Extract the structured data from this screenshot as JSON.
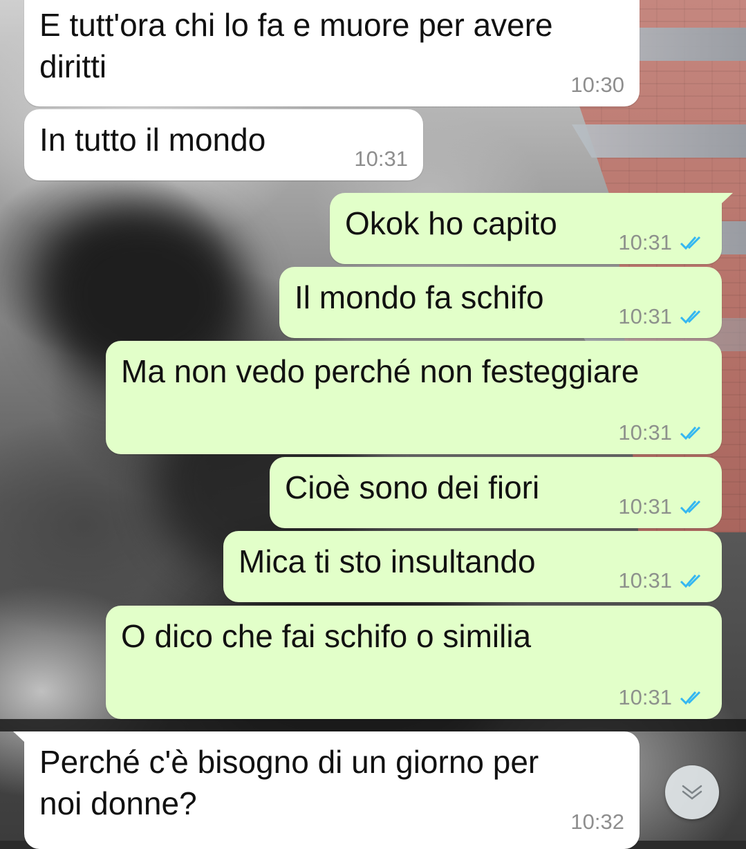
{
  "colors": {
    "incoming_bubble": "#ffffff",
    "outgoing_bubble": "#e2ffc9",
    "read_ticks": "#34b7f1",
    "timestamp": "#8d918c"
  },
  "messages": [
    {
      "direction": "incoming",
      "text": "E tutt'ora chi lo fa e muore per avere\ndiritti",
      "time": "10:30"
    },
    {
      "direction": "incoming",
      "text": "In tutto il mondo",
      "time": "10:31"
    },
    {
      "direction": "outgoing",
      "text": "Okok ho capito",
      "time": "10:31",
      "status": "read"
    },
    {
      "direction": "outgoing",
      "text": "Il mondo fa schifo",
      "time": "10:31",
      "status": "read"
    },
    {
      "direction": "outgoing",
      "text": "Ma non vedo perché non festeggiare",
      "time": "10:31",
      "status": "read"
    },
    {
      "direction": "outgoing",
      "text": "Cioè sono dei fiori",
      "time": "10:31",
      "status": "read"
    },
    {
      "direction": "outgoing",
      "text": "Mica ti sto insultando",
      "time": "10:31",
      "status": "read"
    },
    {
      "direction": "outgoing",
      "text": "O dico che fai schifo o similia",
      "time": "10:31",
      "status": "read"
    },
    {
      "direction": "incoming",
      "text": "Perché c'è bisogno di un giorno per\nnoi donne?",
      "time": "10:32"
    }
  ],
  "scroll_button": {
    "icon": "chevron-double-down-icon"
  }
}
